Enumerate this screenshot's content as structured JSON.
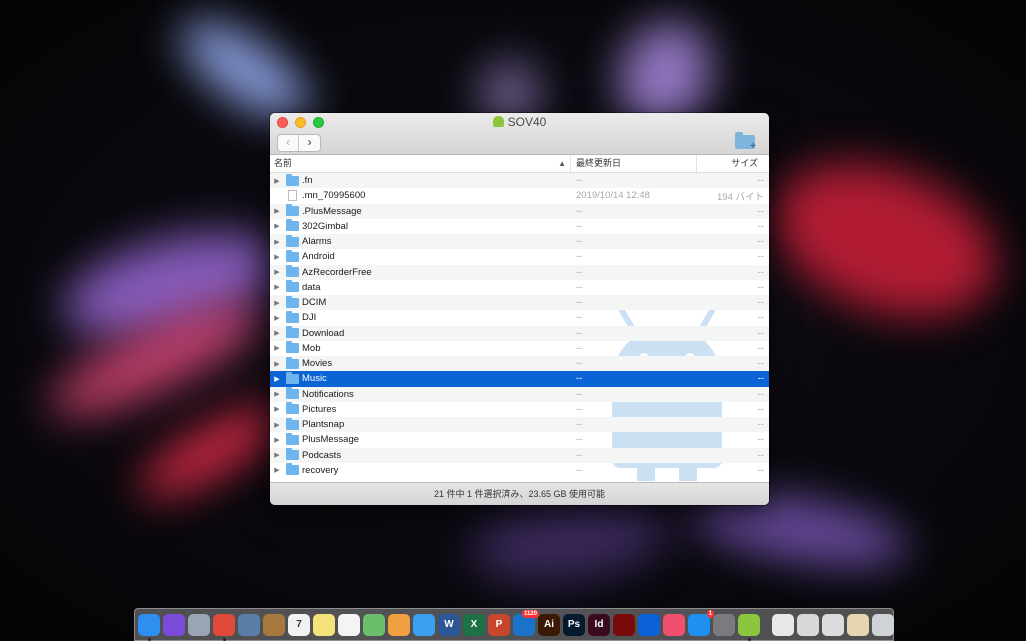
{
  "window": {
    "title": "SOV40",
    "back_glyph": "‹",
    "forward_glyph": "›"
  },
  "columns": {
    "name": "名前",
    "date": "最終更新日",
    "size": "サイズ",
    "sort_indicator": "▲"
  },
  "rows": [
    {
      "name": ".fn",
      "kind": "folder",
      "date": "--",
      "size": "--",
      "selected": false
    },
    {
      "name": ".mn_70995600",
      "kind": "file",
      "date": "2019/10/14 12:48",
      "size": "194 バイト",
      "selected": false
    },
    {
      "name": ".PlusMessage",
      "kind": "folder",
      "date": "--",
      "size": "--",
      "selected": false
    },
    {
      "name": "302Gimbal",
      "kind": "folder",
      "date": "--",
      "size": "--",
      "selected": false
    },
    {
      "name": "Alarms",
      "kind": "folder",
      "date": "--",
      "size": "--",
      "selected": false
    },
    {
      "name": "Android",
      "kind": "folder",
      "date": "--",
      "size": "--",
      "selected": false
    },
    {
      "name": "AzRecorderFree",
      "kind": "folder",
      "date": "--",
      "size": "--",
      "selected": false
    },
    {
      "name": "data",
      "kind": "folder",
      "date": "--",
      "size": "--",
      "selected": false
    },
    {
      "name": "DCIM",
      "kind": "folder",
      "date": "--",
      "size": "--",
      "selected": false
    },
    {
      "name": "DJI",
      "kind": "folder",
      "date": "--",
      "size": "--",
      "selected": false
    },
    {
      "name": "Download",
      "kind": "folder",
      "date": "--",
      "size": "--",
      "selected": false
    },
    {
      "name": "Mob",
      "kind": "folder",
      "date": "--",
      "size": "--",
      "selected": false
    },
    {
      "name": "Movies",
      "kind": "folder",
      "date": "--",
      "size": "--",
      "selected": false
    },
    {
      "name": "Music",
      "kind": "folder",
      "date": "--",
      "size": "--",
      "selected": true
    },
    {
      "name": "Notifications",
      "kind": "folder",
      "date": "--",
      "size": "--",
      "selected": false
    },
    {
      "name": "Pictures",
      "kind": "folder",
      "date": "--",
      "size": "--",
      "selected": false
    },
    {
      "name": "Plantsnap",
      "kind": "folder",
      "date": "--",
      "size": "--",
      "selected": false
    },
    {
      "name": "PlusMessage",
      "kind": "folder",
      "date": "--",
      "size": "--",
      "selected": false
    },
    {
      "name": "Podcasts",
      "kind": "folder",
      "date": "--",
      "size": "--",
      "selected": false
    },
    {
      "name": "recovery",
      "kind": "folder",
      "date": "--",
      "size": "--",
      "selected": false
    }
  ],
  "status": "21 件中 1 件選択済み、23.65 GB 使用可能",
  "dock": [
    {
      "name": "finder-icon",
      "label": "",
      "color": "#2f8ff0",
      "running": true
    },
    {
      "name": "siri-icon",
      "label": "",
      "color": "#7a4bd8",
      "running": false
    },
    {
      "name": "launchpad-icon",
      "label": "",
      "color": "#9aa4b4",
      "running": false
    },
    {
      "name": "chrome-icon",
      "label": "",
      "color": "#e04a3a",
      "running": true
    },
    {
      "name": "preview-icon",
      "label": "",
      "color": "#5a7ea8",
      "running": false
    },
    {
      "name": "notebook-icon",
      "label": "",
      "color": "#a8793e",
      "running": false
    },
    {
      "name": "calendar-icon",
      "label": "7",
      "color": "#f2f2f2",
      "running": false
    },
    {
      "name": "notes-icon",
      "label": "",
      "color": "#f4e27a",
      "running": false
    },
    {
      "name": "reminders-icon",
      "label": "",
      "color": "#f4f4f4",
      "running": false
    },
    {
      "name": "maps-icon",
      "label": "",
      "color": "#6cbf6a",
      "running": false
    },
    {
      "name": "photos-icon",
      "label": "",
      "color": "#f0a040",
      "running": false
    },
    {
      "name": "messages-icon",
      "label": "",
      "color": "#3aa0f0",
      "running": false
    },
    {
      "name": "word-icon",
      "label": "W",
      "color": "#2b5797",
      "running": false
    },
    {
      "name": "excel-icon",
      "label": "X",
      "color": "#1e7145",
      "running": false
    },
    {
      "name": "powerpoint-icon",
      "label": "P",
      "color": "#c8462b",
      "running": false
    },
    {
      "name": "outlook-icon",
      "label": "",
      "color": "#1a73c8",
      "running": false,
      "badge": "1120"
    },
    {
      "name": "illustrator-icon",
      "label": "Ai",
      "color": "#3a1a06",
      "running": false
    },
    {
      "name": "photoshop-icon",
      "label": "Ps",
      "color": "#061a2e",
      "running": false
    },
    {
      "name": "indesign-icon",
      "label": "Id",
      "color": "#3a0a1e",
      "running": false
    },
    {
      "name": "acrobat-icon",
      "label": "",
      "color": "#7a0a0a",
      "running": false
    },
    {
      "name": "dropbox-icon",
      "label": "",
      "color": "#0a62d6",
      "running": false
    },
    {
      "name": "itunes-icon",
      "label": "",
      "color": "#f0506e",
      "running": false
    },
    {
      "name": "appstore-icon",
      "label": "",
      "color": "#1e90f0",
      "running": false,
      "badge": "1"
    },
    {
      "name": "system-preferences-icon",
      "label": "",
      "color": "#7a7a80",
      "running": false
    },
    {
      "name": "android-file-transfer-icon",
      "label": "",
      "color": "#8cc63f",
      "running": true
    },
    {
      "name": "documents-stack-icon",
      "label": "",
      "color": "#e8e8e8",
      "running": false
    },
    {
      "name": "printer-icon",
      "label": "",
      "color": "#d8d8d8",
      "running": false
    },
    {
      "name": "downloads-stack-icon",
      "label": "",
      "color": "#dcdcdc",
      "running": false
    },
    {
      "name": "desktop-stack-icon",
      "label": "",
      "color": "#e6d6b0",
      "running": false
    },
    {
      "name": "trash-icon",
      "label": "",
      "color": "#cfd3d6",
      "running": false
    }
  ]
}
